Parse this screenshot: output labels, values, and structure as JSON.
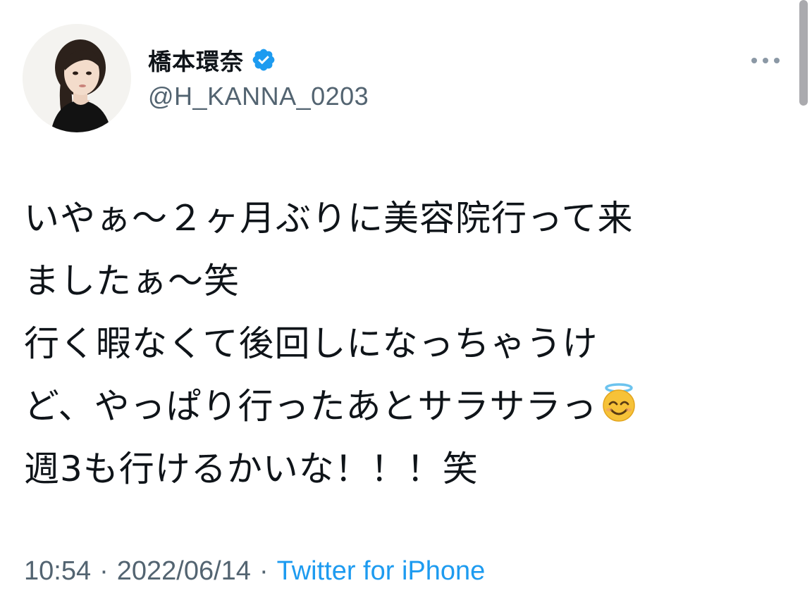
{
  "tweet": {
    "author": {
      "display_name": "橋本環奈",
      "handle": "@H_KANNA_0203",
      "verified_icon": "verified-badge-icon",
      "avatar_icon": "avatar-photo"
    },
    "more_icon": "more-horizontal-icon",
    "text_lines": [
      "いやぁ〜２ヶ月ぶりに美容院行って来",
      "ましたぁ〜笑",
      "行く暇なくて後回しになっちゃうけ",
      "ど、やっぱり行ったあとサラサラっ",
      "週3も行けるかいな！！！笑"
    ],
    "emoji": "smiling-face-with-halo-emoji",
    "time": "10:54",
    "separator": "·",
    "date": "2022/06/14",
    "source": "Twitter for iPhone"
  },
  "colors": {
    "text": "#0f1419",
    "secondary": "#536471",
    "accent": "#1d9bf0"
  }
}
